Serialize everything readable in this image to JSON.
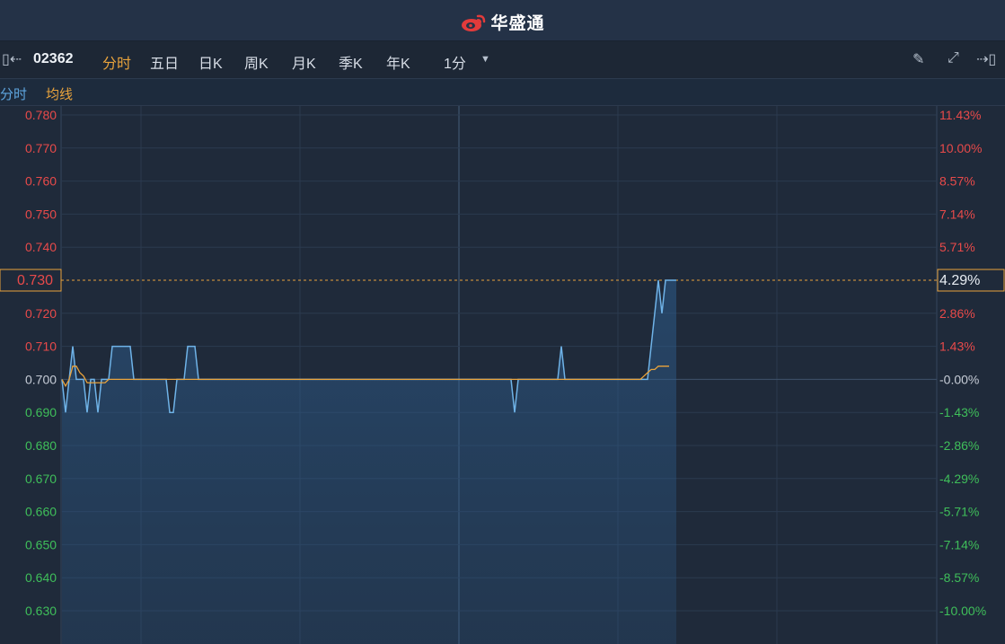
{
  "header": {
    "brand": "华盛通",
    "brand_color": "#e23b3b"
  },
  "toolbar": {
    "code": "02362",
    "tabs": [
      "分时",
      "五日",
      "日K",
      "周K",
      "月K",
      "季K",
      "年K"
    ],
    "active_tab": "分时",
    "interval": "1分",
    "icons": [
      "collapse-left-icon",
      "chevron-down-icon",
      "pencil-icon",
      "expand-icon",
      "collapse-right-icon"
    ]
  },
  "legend": {
    "price": "分时",
    "avg": "均线"
  },
  "colors": {
    "up": "#e84a4a",
    "down": "#3fbf5a",
    "price_line": "#6fb3e8",
    "avg_line": "#e9a33c",
    "highlight": "#e9a33c"
  },
  "chart_data": {
    "type": "line",
    "prev_close": 0.7,
    "ylim": [
      0.625,
      0.78
    ],
    "left_ticks": [
      "0.780",
      "0.770",
      "0.760",
      "0.750",
      "0.740",
      "0.730",
      "0.720",
      "0.710",
      "0.700",
      "0.690",
      "0.680",
      "0.670",
      "0.660",
      "0.650",
      "0.640",
      "0.630"
    ],
    "right_ticks": [
      "11.43%",
      "10.00%",
      "8.57%",
      "7.14%",
      "5.71%",
      "4.29%",
      "2.86%",
      "1.43%",
      "-0.00%",
      "-1.43%",
      "-2.86%",
      "-4.29%",
      "-5.71%",
      "-7.14%",
      "-8.57%",
      "-10.00%"
    ],
    "highlight": {
      "price": "0.730",
      "percent": "4.29%"
    },
    "series": [
      {
        "values": [
          0.7,
          0.69,
          0.7,
          0.71,
          0.7,
          0.7,
          0.7,
          0.69,
          0.7,
          0.7,
          0.69,
          0.7,
          0.7,
          0.7,
          0.71,
          0.71,
          0.71,
          0.71,
          0.71,
          0.71,
          0.7,
          0.7,
          0.7,
          0.7,
          0.7,
          0.7,
          0.7,
          0.7,
          0.7,
          0.7,
          0.69,
          0.69,
          0.7,
          0.7,
          0.7,
          0.71,
          0.71,
          0.71,
          0.7,
          0.7,
          0.7,
          0.7,
          0.7,
          0.7,
          0.7,
          0.7,
          0.7,
          0.7,
          0.7,
          0.7,
          0.7,
          0.7,
          0.7,
          0.7,
          0.7,
          0.7,
          0.7,
          0.7,
          0.7,
          0.7,
          0.7,
          0.7,
          0.7,
          0.7,
          0.7,
          0.7,
          0.7,
          0.7,
          0.7,
          0.7,
          0.7,
          0.7,
          0.7,
          0.7,
          0.7,
          0.7,
          0.7,
          0.7,
          0.7,
          0.7,
          0.7,
          0.7,
          0.7,
          0.7,
          0.7,
          0.7,
          0.7,
          0.7,
          0.7,
          0.7,
          0.7,
          0.7,
          0.7,
          0.7,
          0.7,
          0.7,
          0.7,
          0.7,
          0.7,
          0.7,
          0.7,
          0.7,
          0.7,
          0.7,
          0.7,
          0.7,
          0.7,
          0.7,
          0.7,
          0.7,
          0.7,
          0.7,
          0.7,
          0.7,
          0.7,
          0.7,
          0.7,
          0.7,
          0.7,
          0.7,
          0.7,
          0.7,
          0.7,
          0.7,
          0.7,
          0.7,
          0.69,
          0.7,
          0.7,
          0.7,
          0.7,
          0.7,
          0.7,
          0.7,
          0.7,
          0.7,
          0.7,
          0.7,
          0.7,
          0.71,
          0.7,
          0.7,
          0.7,
          0.7,
          0.7,
          0.7,
          0.7,
          0.7,
          0.7,
          0.7,
          0.7,
          0.7,
          0.7,
          0.7,
          0.7,
          0.7,
          0.7,
          0.7,
          0.7,
          0.7,
          0.7,
          0.7,
          0.7,
          0.7,
          0.71,
          0.72,
          0.73,
          0.72,
          0.73,
          0.73,
          0.73,
          0.73
        ]
      },
      {
        "values": [
          0.7,
          0.698,
          0.7,
          0.704,
          0.704,
          0.702,
          0.701,
          0.699,
          0.699,
          0.699,
          0.699,
          0.699,
          0.699,
          0.7,
          0.7,
          0.7,
          0.7,
          0.7,
          0.7,
          0.7,
          0.7,
          0.7,
          0.7,
          0.7,
          0.7,
          0.7,
          0.7,
          0.7,
          0.7,
          0.7,
          0.7,
          0.7,
          0.7,
          0.7,
          0.7,
          0.7,
          0.7,
          0.7,
          0.7,
          0.7,
          0.7,
          0.7,
          0.7,
          0.7,
          0.7,
          0.7,
          0.7,
          0.7,
          0.7,
          0.7,
          0.7,
          0.7,
          0.7,
          0.7,
          0.7,
          0.7,
          0.7,
          0.7,
          0.7,
          0.7,
          0.7,
          0.7,
          0.7,
          0.7,
          0.7,
          0.7,
          0.7,
          0.7,
          0.7,
          0.7,
          0.7,
          0.7,
          0.7,
          0.7,
          0.7,
          0.7,
          0.7,
          0.7,
          0.7,
          0.7,
          0.7,
          0.7,
          0.7,
          0.7,
          0.7,
          0.7,
          0.7,
          0.7,
          0.7,
          0.7,
          0.7,
          0.7,
          0.7,
          0.7,
          0.7,
          0.7,
          0.7,
          0.7,
          0.7,
          0.7,
          0.7,
          0.7,
          0.7,
          0.7,
          0.7,
          0.7,
          0.7,
          0.7,
          0.7,
          0.7,
          0.7,
          0.7,
          0.7,
          0.7,
          0.7,
          0.7,
          0.7,
          0.7,
          0.7,
          0.7,
          0.7,
          0.7,
          0.7,
          0.7,
          0.7,
          0.7,
          0.7,
          0.7,
          0.7,
          0.7,
          0.7,
          0.7,
          0.7,
          0.7,
          0.7,
          0.7,
          0.7,
          0.7,
          0.7,
          0.7,
          0.7,
          0.7,
          0.7,
          0.7,
          0.7,
          0.7,
          0.7,
          0.7,
          0.7,
          0.7,
          0.7,
          0.7,
          0.7,
          0.7,
          0.7,
          0.7,
          0.7,
          0.7,
          0.7,
          0.7,
          0.7,
          0.7,
          0.701,
          0.702,
          0.703,
          0.703,
          0.704,
          0.704,
          0.704,
          0.704
        ]
      }
    ]
  }
}
